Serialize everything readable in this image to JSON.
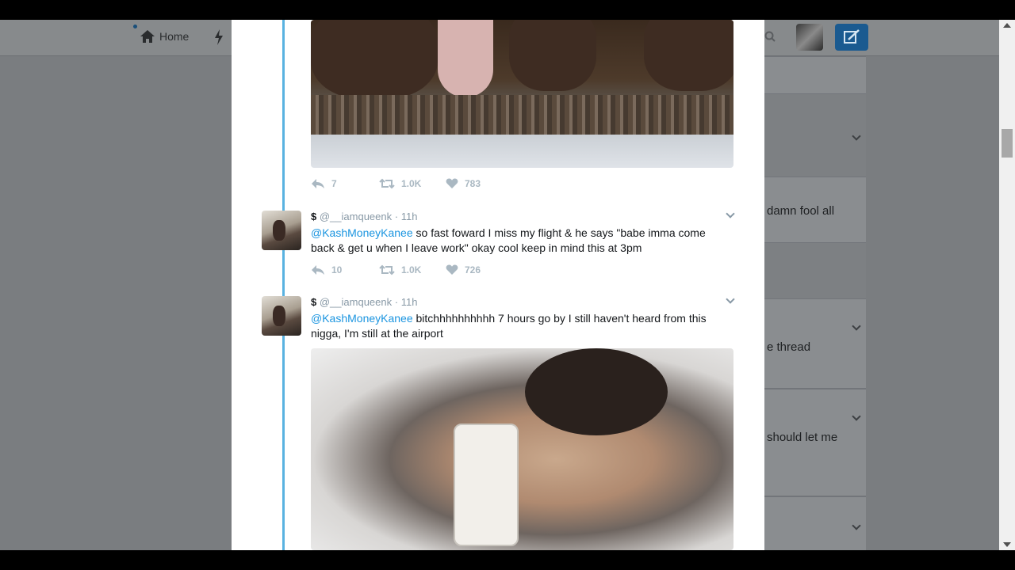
{
  "topbar": {
    "home_label": "Home"
  },
  "right_column": {
    "snippets": [
      "damn fool all",
      "e thread",
      "should let me"
    ]
  },
  "media1_actions": {
    "replies": "7",
    "retweets": "1.0K",
    "likes": "783"
  },
  "tweets": [
    {
      "display_name": "$",
      "handle": "@__iamqueenk",
      "time": "11h",
      "mention": "@KashMoneyKanee",
      "text": " so fast foward I miss my flight & he says \"babe imma come back & get u when I leave work\" okay cool keep in mind this at 3pm",
      "replies": "10",
      "retweets": "1.0K",
      "likes": "726"
    },
    {
      "display_name": "$",
      "handle": "@__iamqueenk",
      "time": "11h",
      "mention": "@KashMoneyKanee",
      "text": " bitchhhhhhhhhh 7 hours go by I still haven't heard from this nigga, I'm still at the airport"
    }
  ],
  "colors": {
    "accent": "#1b95e0",
    "thread_line": "#59b2e0",
    "compose": "#1a5a90"
  }
}
